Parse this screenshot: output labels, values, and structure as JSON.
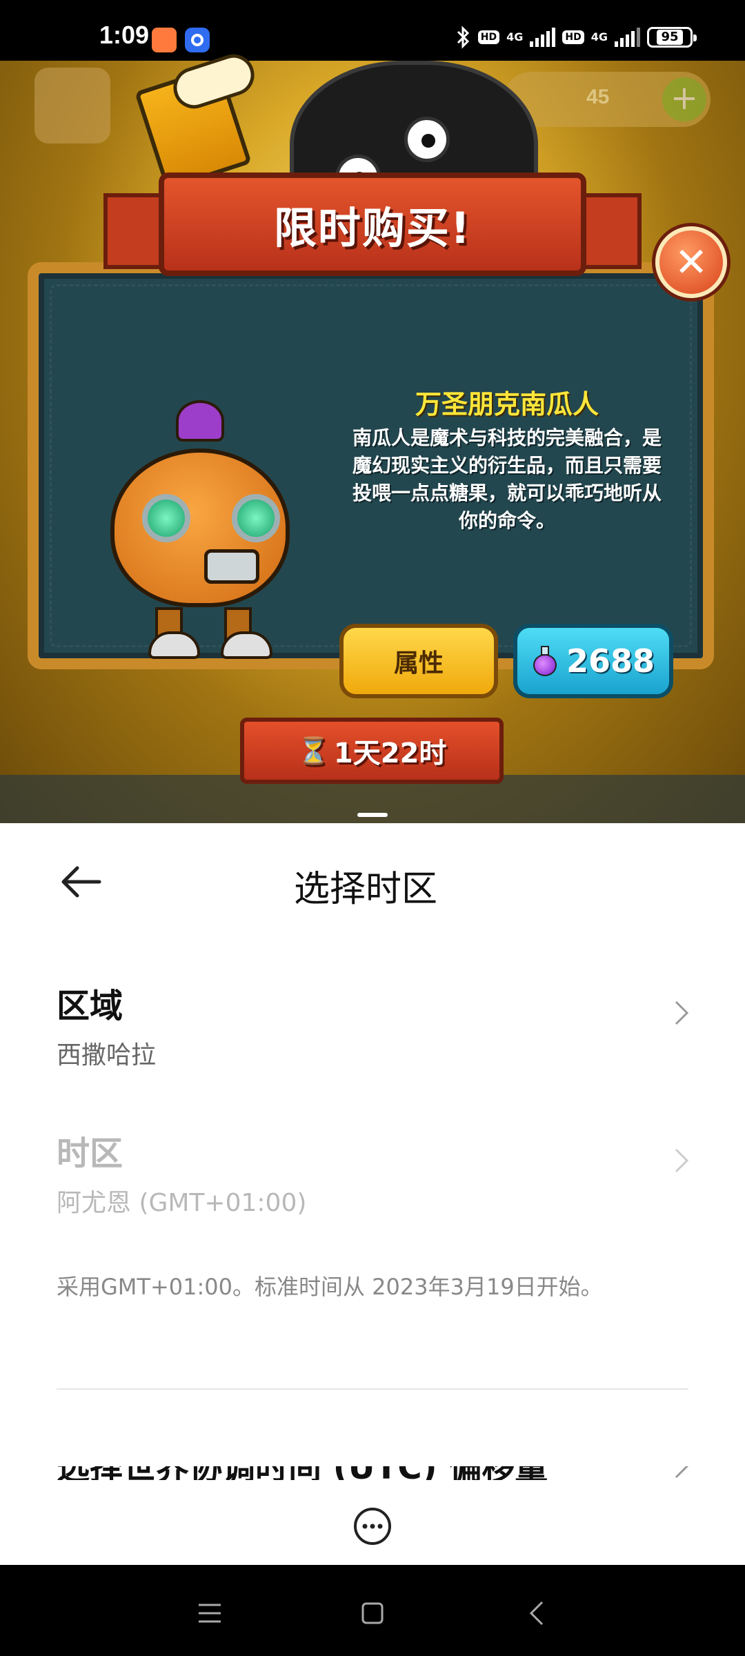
{
  "status_bar": {
    "time": "1:09",
    "hd1": "HD",
    "net1": "4G",
    "hd2": "HD",
    "net2": "4G",
    "battery": "95",
    "icons": [
      "bluetooth-icon",
      "signal-icon",
      "battery-icon"
    ]
  },
  "game": {
    "top_counter": "45",
    "banner_title": "限时购买!",
    "item_name": "万圣朋克南瓜人",
    "item_description": "南瓜人是魔术与科技的完美融合，是魔幻现实主义的衍生品，而且只需要投喂一点点糖果，就可以乖巧地听从你的命令。",
    "attr_button": "属性",
    "price": "2688",
    "timer": "1天22时",
    "colors": {
      "title": "#ffe63a",
      "buy": "#1aa3cf",
      "attr": "#f0a90c",
      "banner": "#d0401f"
    }
  },
  "settings": {
    "title": "选择时区",
    "region_label": "区域",
    "region_value": "西撒哈拉",
    "timezone_label": "时区",
    "timezone_value": "阿尤恩 (GMT+01:00)",
    "note": "采用GMT+01:00。标准时间从 2023年3月19日开始。",
    "utc_offset_label": "选择世界协调时间 (UTC) 偏移量"
  }
}
